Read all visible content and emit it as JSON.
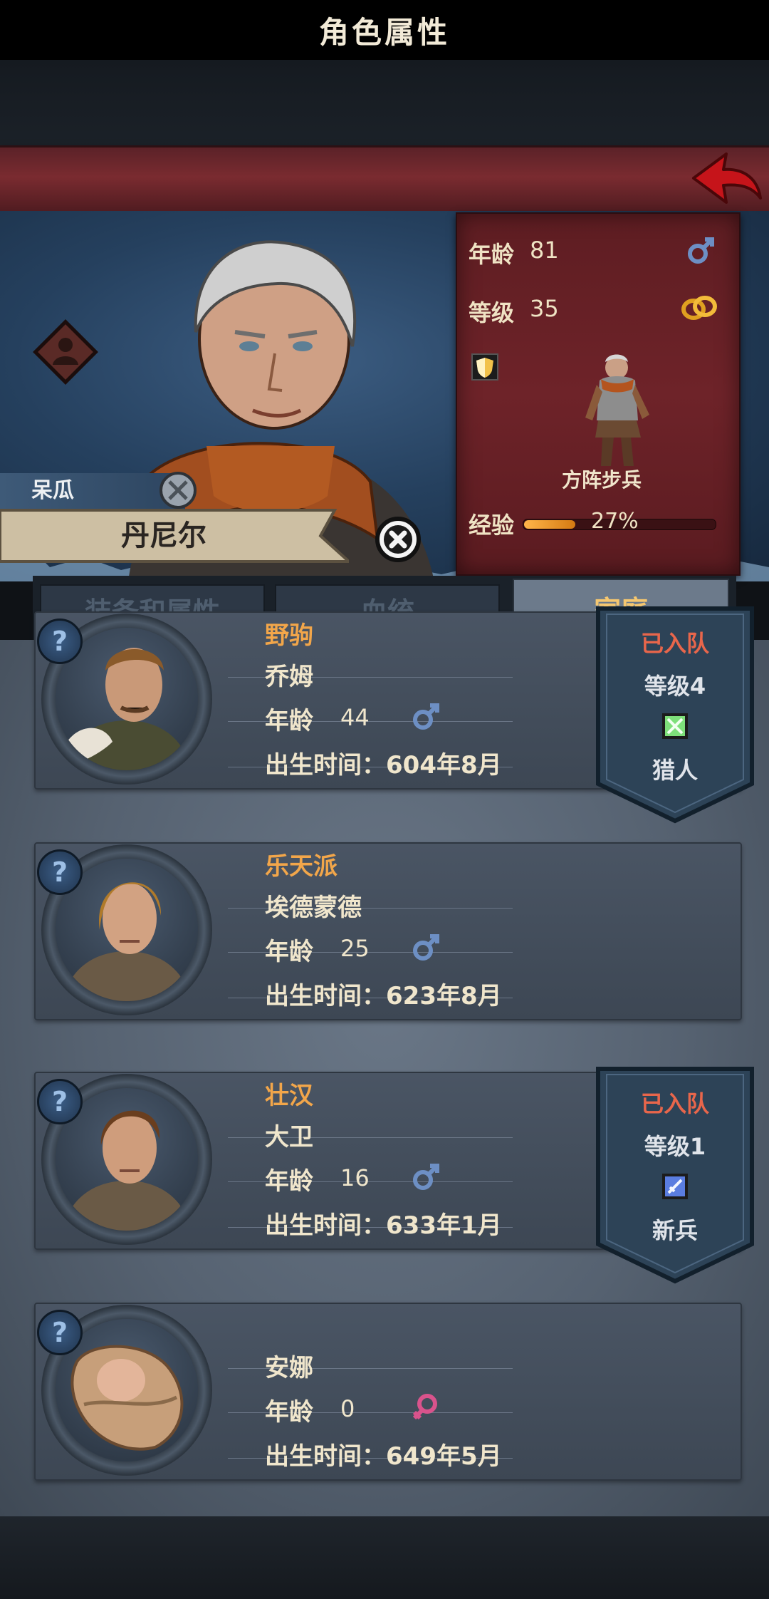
{
  "header": {
    "title": "角色属性"
  },
  "hero": {
    "nickname": "呆瓜",
    "name": "丹尼尔",
    "age_label": "年龄",
    "age": "81",
    "level_label": "等级",
    "level": "35",
    "unit_class": "方阵步兵",
    "exp_label": "经验",
    "exp_text": "27%",
    "exp_progress": 0.27,
    "exp_bar_color": "#f0a030"
  },
  "tabs": [
    {
      "label": "装备和属性",
      "active": false
    },
    {
      "label": "血统",
      "active": false
    },
    {
      "label": "家庭",
      "active": true
    }
  ],
  "family": [
    {
      "trait": "野驹",
      "name": "乔姆",
      "age_label": "年龄",
      "age": "44",
      "gender": "male",
      "birth": "出生时间：604年8月",
      "ribbon": {
        "status": "已入队",
        "level": "等级4",
        "class": "猎人",
        "class_icon": "hunter-bow-icon"
      }
    },
    {
      "trait": "乐天派",
      "name": "埃德蒙德",
      "age_label": "年龄",
      "age": "25",
      "gender": "male",
      "birth": "出生时间：623年8月"
    },
    {
      "trait": "壮汉",
      "name": "大卫",
      "age_label": "年龄",
      "age": "16",
      "gender": "male",
      "birth": "出生时间：633年1月",
      "ribbon": {
        "status": "已入队",
        "level": "等级1",
        "class": "新兵",
        "class_icon": "recruit-sword-icon"
      }
    },
    {
      "trait": "",
      "name": "安娜",
      "age_label": "年龄",
      "age": "0",
      "gender": "female",
      "birth": "出生时间：649年5月"
    }
  ],
  "colors": {
    "trait": "#f2a64a",
    "male": "#6d8fc4",
    "female": "#d9538c",
    "ribbon_status": "#e8664b",
    "tab_active_text": "#f5c770"
  }
}
